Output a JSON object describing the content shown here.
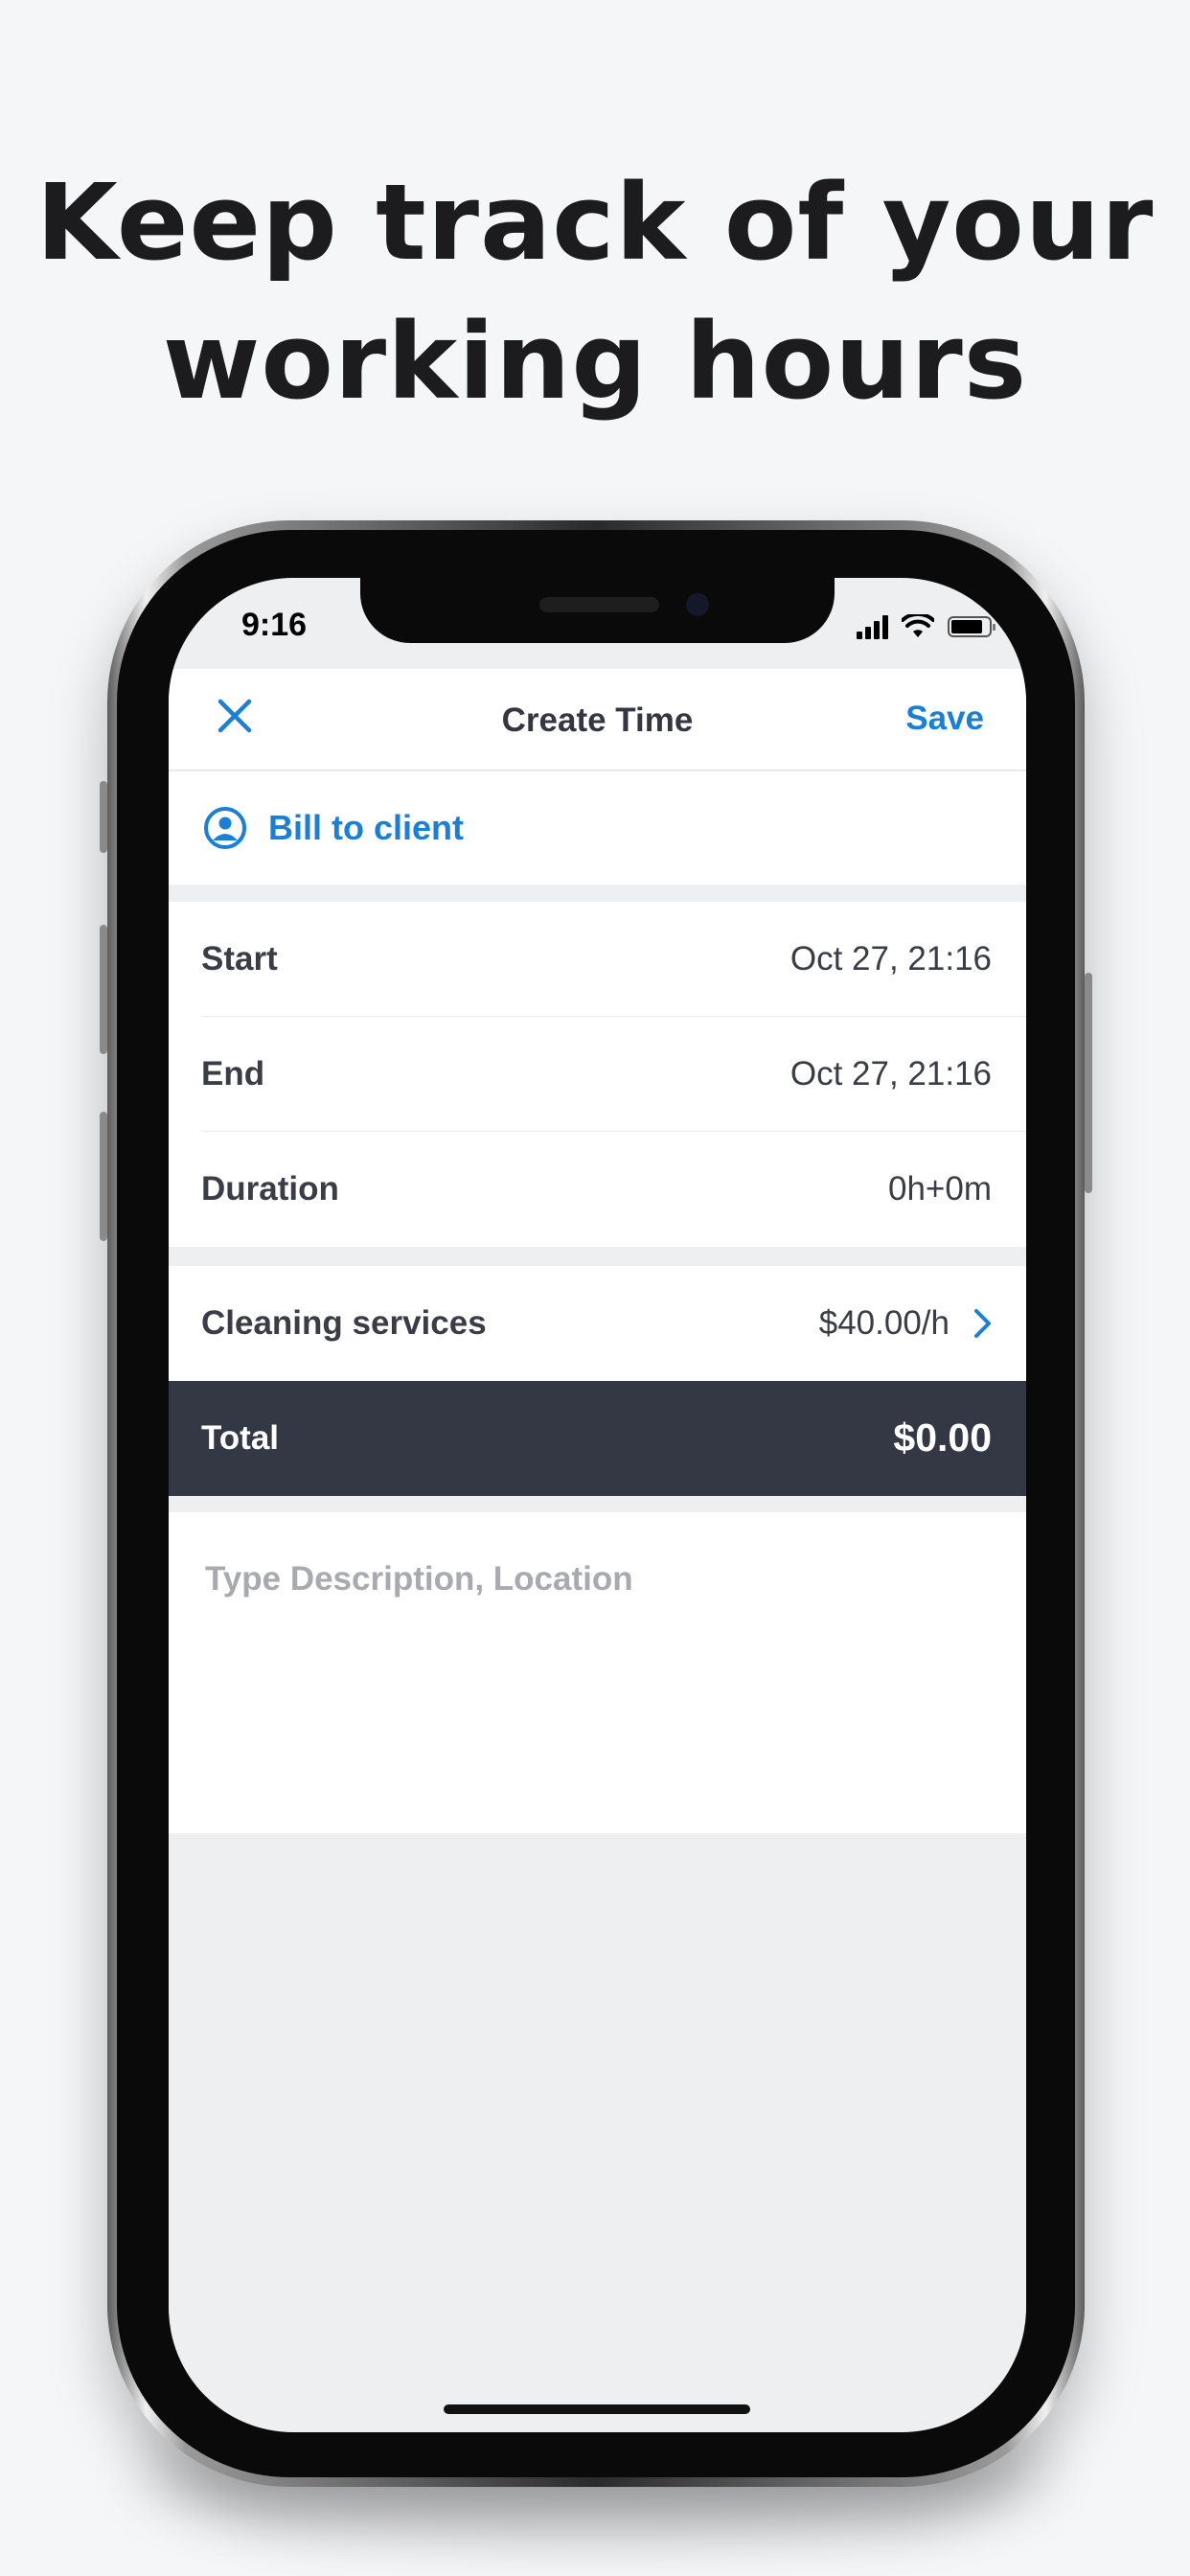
{
  "headline": {
    "line1": "Keep track of your",
    "line2": "working hours"
  },
  "status_bar": {
    "time": "9:16",
    "icons": [
      "signal-icon",
      "wifi-icon",
      "battery-icon"
    ]
  },
  "nav": {
    "title": "Create Time",
    "save_label": "Save",
    "close_icon": "close-icon"
  },
  "bill": {
    "label": "Bill to client",
    "icon": "person-circle-icon"
  },
  "time_rows": [
    {
      "label": "Start",
      "value": "Oct 27, 21:16"
    },
    {
      "label": "End",
      "value": "Oct 27, 21:16"
    },
    {
      "label": "Duration",
      "value": "0h+0m"
    }
  ],
  "service": {
    "label": "Cleaning services",
    "rate": "$40.00/h",
    "icon": "chevron-right-icon"
  },
  "total": {
    "label": "Total",
    "value": "$0.00"
  },
  "description": {
    "placeholder": "Type Description, Location",
    "value": ""
  },
  "colors": {
    "accent": "#1a7fd6",
    "total_bar": "#343844",
    "text": "#3a3d45",
    "placeholder": "#a8aab0",
    "background": "#f5f6f8"
  }
}
